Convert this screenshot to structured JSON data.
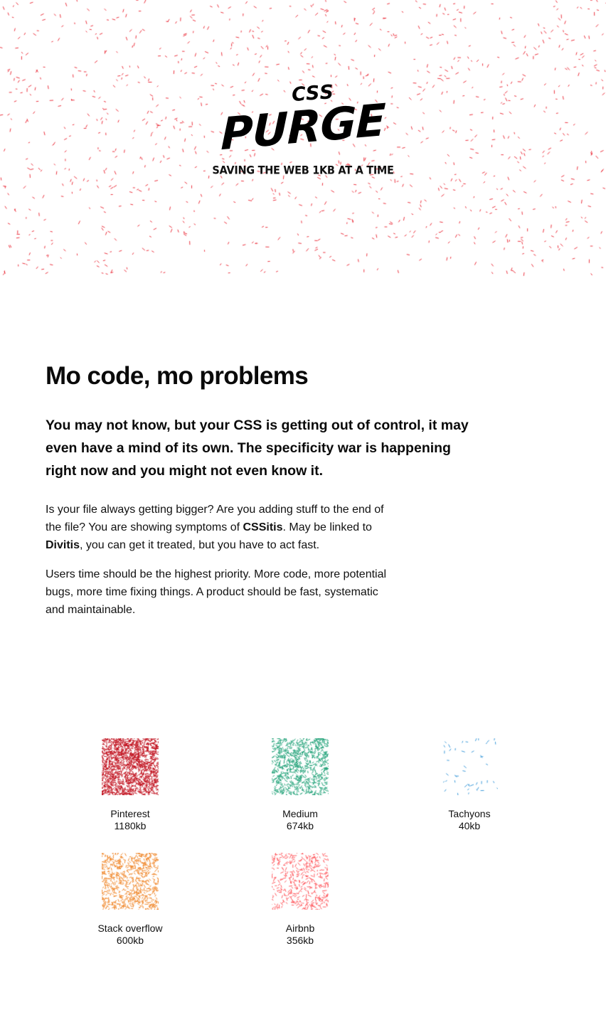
{
  "colors": {
    "hero_dots": "#e8101e",
    "pinterest": "#c1121f",
    "medium": "#24a37a",
    "tachyons": "#3d9ad9",
    "stack_overflow": "#f0892e",
    "airbnb": "#ff5a5f"
  },
  "logo": {
    "small": "CSS",
    "big": "PURGE",
    "tagline": "SAVING THE WEB 1KB AT A TIME"
  },
  "content": {
    "heading": "Mo code, mo problems",
    "lead": "You may not know, but your CSS is getting out of control, it may even have a mind of its own. The specificity war is happening right now and you might not even know it.",
    "p1_a": "Is your file always getting bigger? Are you adding stuff to the end of the file? You are showing symptoms of ",
    "p1_b": "CSSitis",
    "p1_c": ". May be linked to ",
    "p1_d": "Divitis",
    "p1_e": ", you can get it treated, but you have to act fast.",
    "p2": "Users time should be the highest priority. More code, more potential bugs, more time fixing things. A product should be fast, systematic and maintainable."
  },
  "sites": [
    {
      "name": "Pinterest",
      "size": "1180kb",
      "size_kb": 1180,
      "color_key": "pinterest"
    },
    {
      "name": "Medium",
      "size": "674kb",
      "size_kb": 674,
      "color_key": "medium"
    },
    {
      "name": "Tachyons",
      "size": "40kb",
      "size_kb": 40,
      "color_key": "tachyons"
    },
    {
      "name": "Stack overflow",
      "size": "600kb",
      "size_kb": 600,
      "color_key": "stack_overflow"
    },
    {
      "name": "Airbnb",
      "size": "356kb",
      "size_kb": 356,
      "color_key": "airbnb"
    }
  ]
}
